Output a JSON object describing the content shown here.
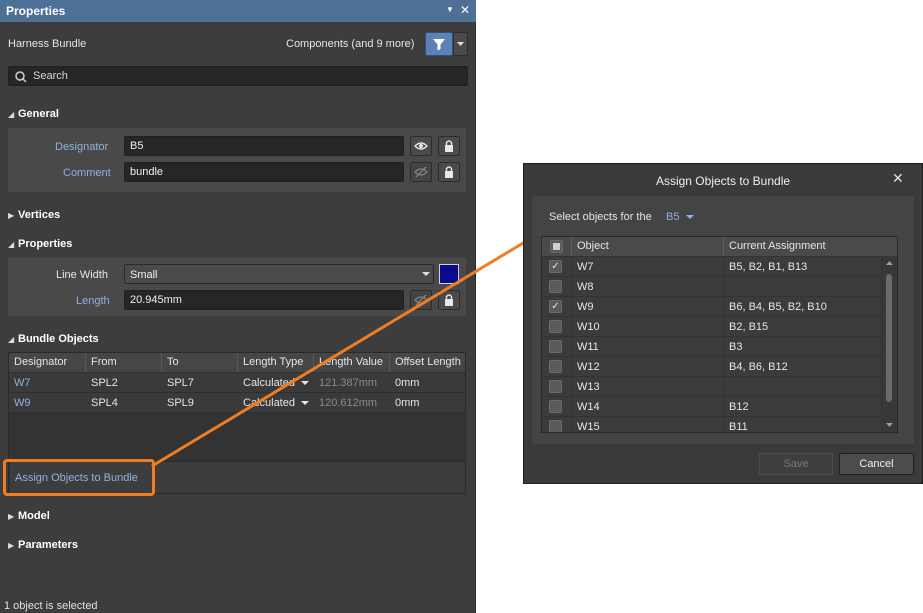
{
  "panel": {
    "title": "Properties",
    "pin_icon": "pin-icon",
    "close_glyph": "✕",
    "object_type": "Harness Bundle",
    "filter_summary": "Components (and 9 more)",
    "search_placeholder": "Search"
  },
  "general": {
    "header": "General",
    "designator_label": "Designator",
    "designator_value": "B5",
    "comment_label": "Comment",
    "comment_value": "bundle"
  },
  "vertices": {
    "header": "Vertices"
  },
  "properties": {
    "header": "Properties",
    "line_width_label": "Line Width",
    "line_width_value": "Small",
    "line_color": "#0a0a8c",
    "length_label": "Length",
    "length_value": "20.945mm"
  },
  "bundle_objects": {
    "header": "Bundle Objects",
    "columns": [
      "Designator",
      "From",
      "To",
      "Length Type",
      "Length Value",
      "Offset Length"
    ],
    "rows": [
      {
        "designator": "W7",
        "from": "SPL2",
        "to": "SPL7",
        "length_type": "Calculated",
        "length_value": "121.387mm",
        "offset": "0mm"
      },
      {
        "designator": "W9",
        "from": "SPL4",
        "to": "SPL9",
        "length_type": "Calculated",
        "length_value": "120.612mm",
        "offset": "0mm"
      }
    ],
    "assign_link": "Assign Objects to Bundle"
  },
  "model": {
    "header": "Model"
  },
  "parameters": {
    "header": "Parameters"
  },
  "status": "1 object is selected",
  "dialog": {
    "title": "Assign Objects to Bundle",
    "select_prefix": "Select objects for the",
    "bundle": "B5",
    "columns": [
      "Object",
      "Current Assignment"
    ],
    "rows": [
      {
        "checked": true,
        "object": "W7",
        "assignment": "B5, B2, B1, B13"
      },
      {
        "checked": false,
        "object": "W8",
        "assignment": ""
      },
      {
        "checked": true,
        "object": "W9",
        "assignment": "B6, B4, B5, B2, B10"
      },
      {
        "checked": false,
        "object": "W10",
        "assignment": "B2, B15"
      },
      {
        "checked": false,
        "object": "W11",
        "assignment": "B3"
      },
      {
        "checked": false,
        "object": "W12",
        "assignment": "B4, B6, B12"
      },
      {
        "checked": false,
        "object": "W13",
        "assignment": ""
      },
      {
        "checked": false,
        "object": "W14",
        "assignment": "B12"
      },
      {
        "checked": false,
        "object": "W15",
        "assignment": "B11"
      }
    ],
    "save_label": "Save",
    "cancel_label": "Cancel"
  },
  "colors": {
    "accent": "#4e6f96",
    "link": "#8fb2de",
    "callout": "#f07d22"
  }
}
